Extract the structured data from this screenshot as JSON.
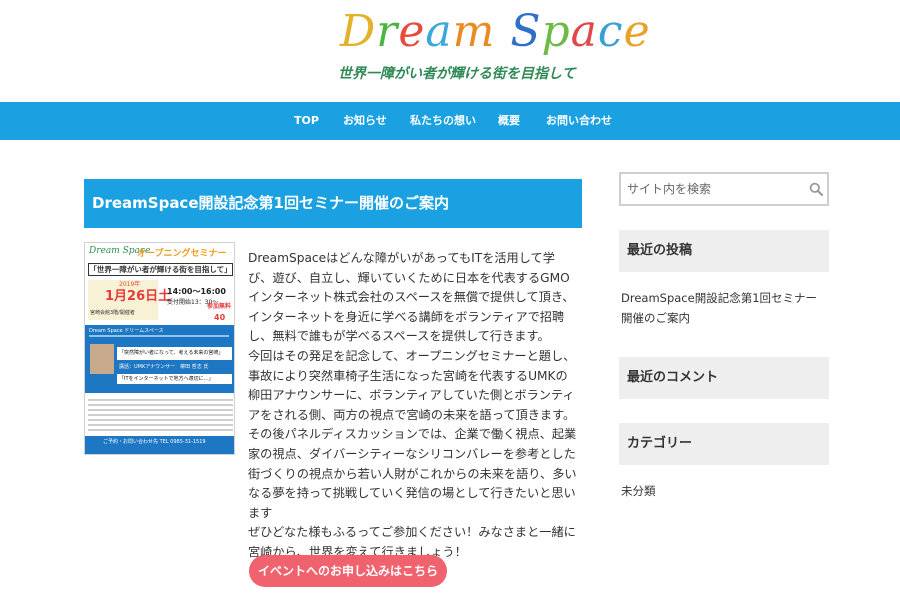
{
  "header": {
    "logo_letters": [
      {
        "ch": "D",
        "color": "#e2b32a"
      },
      {
        "ch": "r",
        "color": "#4bb543"
      },
      {
        "ch": "e",
        "color": "#e64b3c"
      },
      {
        "ch": "a",
        "color": "#3aa8d8"
      },
      {
        "ch": "m",
        "color": "#e98a23"
      },
      {
        "ch": " ",
        "color": "#ffffff"
      },
      {
        "ch": "S",
        "color": "#2f6fc7"
      },
      {
        "ch": "p",
        "color": "#6dbb46"
      },
      {
        "ch": "a",
        "color": "#e04848"
      },
      {
        "ch": "c",
        "color": "#3a9fd6"
      },
      {
        "ch": "e",
        "color": "#e8a226"
      }
    ],
    "tagline": "世界一障がい者が輝ける街を目指して"
  },
  "nav": {
    "items": [
      "TOP",
      "お知らせ",
      "私たちの想い",
      "概要",
      "お問い合わせ"
    ],
    "color": "#1ba1e2"
  },
  "post": {
    "title": "DreamSpace開設記念第1回セミナー開催のご案内",
    "body": "DreamSpaceはどんな障がいがあってもITを活用して学び、遊び、自立し、輝いていくために日本を代表するGMOインターネット株式会社のスペースを無償で提供して頂き、インターネットを身近に学べる講師をボランティアで招聘し、無料で誰もが学べるスペースを提供して行きます。\n今回はその発足を記念して、オープニングセミナーと題し、事故により突然車椅子生活になった宮崎を代表するUMKの柳田アナウンサーに、ボランティアしていた側とボランティアをされる側、両方の視点で宮崎の未来を語って頂きます。その後パネルディスカッションでは、企業で働く視点、起業家の視点、ダイバーシティーなシリコンバレーを参考とした街づくりの視点から若い人財がこれからの未来を語り、多いなる夢を持って挑戦していく発信の場として行きたいと思います\nぜひどなた様もふるってご参加ください！みなさまと一緒に宮崎から、世界を変えて行きましょう！",
    "cta_label": "イベントへのお申し込みはこちら",
    "cta_color": "#f0626d"
  },
  "flyer": {
    "logo": "Dream Space",
    "opening": "オープニングセミナー",
    "tagline": "「世界一障がい者が輝ける街を目指して」",
    "year": "2019年",
    "date": "1月26日土",
    "time": "14:00～16:00",
    "reception": "受付開始13：30～",
    "place": "宮崎会館3階/開催者",
    "free": "参加無料",
    "capacity": "40",
    "section_header": "Dream Space ドリームスペース",
    "speaker": "「突然障がい者になって、考える未来の宮崎」",
    "speaker_sub": "講話：UMKアナウンサー　柳田 哲志 氏",
    "panel": "「ITをインターネットで地方へ適切に…」",
    "contact": "ご予約・お問い合わせ先 TEL 0985-31-1519"
  },
  "sidebar": {
    "search_placeholder": "サイト内を検索",
    "recent_posts_title": "最近の投稿",
    "recent_post": "DreamSpace開設記念第1回セミナー開催のご案内",
    "recent_comments_title": "最近のコメント",
    "categories_title": "カテゴリー",
    "category": "未分類"
  }
}
